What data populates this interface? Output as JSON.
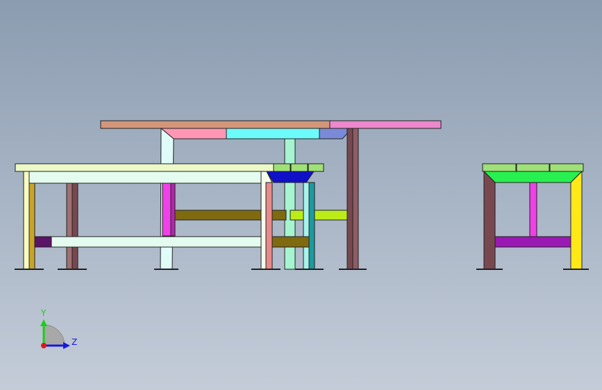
{
  "viewport": {
    "name": "cad-graphics-area",
    "view_orientation": "front",
    "background_gradient": [
      "#8c9cb0",
      "#c4ccd8"
    ]
  },
  "model": {
    "assembly": "table-and-bench-frame",
    "part_colors": {
      "top_board_a": "#d4967a",
      "top_board_b": "#ec88cc",
      "apron_pink": "#ff96b4",
      "apron_cyan": "#6cfafa",
      "apron_blue": "#7a8ad8",
      "bench_seat": "#ecf8c8",
      "bench_apron": "#e4fcf0",
      "rail_olive": "#806a10",
      "rail_lime": "#bcec18",
      "rail_dark_purple": "#5a1468",
      "bench_bracket_blue": "#1010c8",
      "side_stool_top": "#a0e078",
      "side_stool_apron": "#28f050",
      "side_stool_rail": "#9a18b4",
      "leg_gold": "#c8a428",
      "leg_brown": "#784850",
      "leg_magenta": "#f040e8",
      "leg_teal": "#1c9aa0",
      "leg_yellow": "#ffe818"
    }
  },
  "triad": {
    "y_label": "Y",
    "z_label": "Z",
    "y_color": "#18d018",
    "z_color": "#1818e0",
    "x_color": "#e01818"
  }
}
